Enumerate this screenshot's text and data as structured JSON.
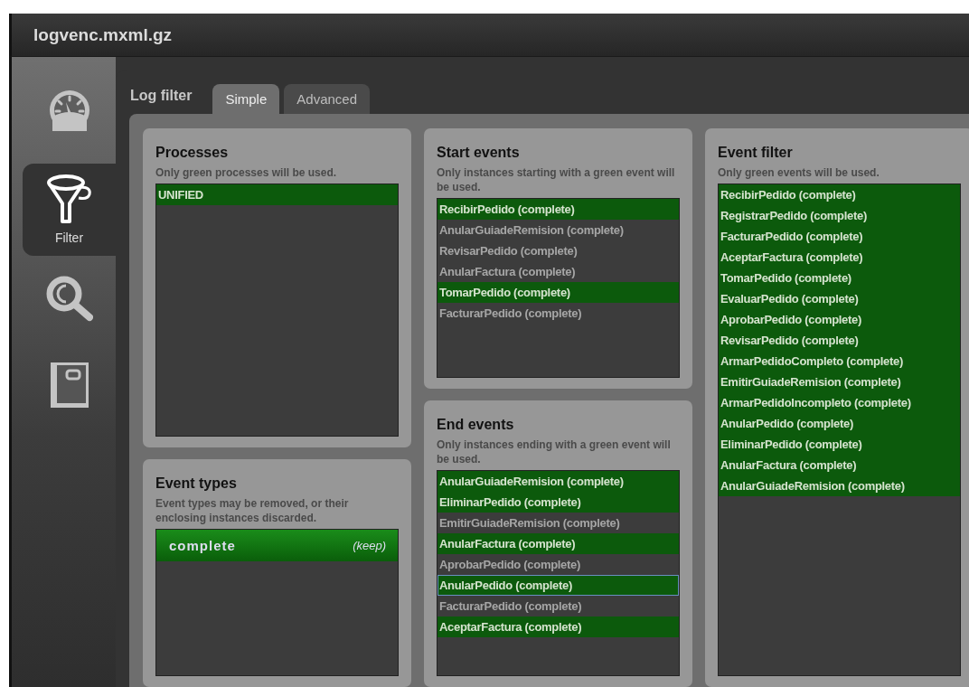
{
  "window": {
    "title": "logvenc.mxml.gz"
  },
  "sidebar": {
    "items": [
      {
        "kind": "dashboard",
        "selected": false
      },
      {
        "kind": "filter",
        "label": "Filter",
        "selected": true
      },
      {
        "kind": "search",
        "selected": false
      },
      {
        "kind": "book",
        "selected": false
      }
    ]
  },
  "log_filter": {
    "title": "Log filter",
    "tabs": [
      {
        "label": "Simple",
        "selected": true
      },
      {
        "label": "Advanced",
        "selected": false
      }
    ]
  },
  "processes": {
    "title": "Processes",
    "description": "Only green processes will be used.",
    "items": [
      {
        "label": "UNIFIED",
        "selected": true
      }
    ]
  },
  "event_types": {
    "title": "Event types",
    "description": "Event types may be removed, or their enclosing instances discarded.",
    "items": [
      {
        "label": "complete",
        "action": "(keep)",
        "selected": true
      }
    ]
  },
  "start_events": {
    "title": "Start events",
    "description": "Only instances starting with a green event will be used.",
    "items": [
      {
        "label": "RecibirPedido (complete)",
        "selected": true
      },
      {
        "label": "AnularGuiadeRemision (complete)",
        "selected": false
      },
      {
        "label": "RevisarPedido (complete)",
        "selected": false
      },
      {
        "label": "AnularFactura (complete)",
        "selected": false
      },
      {
        "label": "TomarPedido (complete)",
        "selected": true
      },
      {
        "label": "FacturarPedido (complete)",
        "selected": false
      }
    ]
  },
  "end_events": {
    "title": "End events",
    "description": "Only instances ending with a green event will be used.",
    "items": [
      {
        "label": "AnularGuiadeRemision (complete)",
        "selected": true,
        "focused": false
      },
      {
        "label": "EliminarPedido (complete)",
        "selected": true,
        "focused": false
      },
      {
        "label": "EmitirGuiadeRemision (complete)",
        "selected": false,
        "focused": false
      },
      {
        "label": "AnularFactura (complete)",
        "selected": true,
        "focused": false
      },
      {
        "label": "AprobarPedido (complete)",
        "selected": false,
        "focused": false
      },
      {
        "label": "AnularPedido (complete)",
        "selected": true,
        "focused": true
      },
      {
        "label": "FacturarPedido (complete)",
        "selected": false,
        "focused": false
      },
      {
        "label": "AceptarFactura (complete)",
        "selected": true,
        "focused": false
      }
    ]
  },
  "event_filter": {
    "title": "Event filter",
    "description": "Only green events will be used.",
    "items": [
      {
        "label": "RecibirPedido (complete)",
        "selected": true
      },
      {
        "label": "RegistrarPedido (complete)",
        "selected": true
      },
      {
        "label": "FacturarPedido (complete)",
        "selected": true
      },
      {
        "label": "AceptarFactura (complete)",
        "selected": true
      },
      {
        "label": "TomarPedido (complete)",
        "selected": true
      },
      {
        "label": "EvaluarPedido (complete)",
        "selected": true
      },
      {
        "label": "AprobarPedido (complete)",
        "selected": true
      },
      {
        "label": "RevisarPedido (complete)",
        "selected": true
      },
      {
        "label": "ArmarPedidoCompleto (complete)",
        "selected": true
      },
      {
        "label": "EmitirGuiadeRemision (complete)",
        "selected": true
      },
      {
        "label": "ArmarPedidoIncompleto (complete)",
        "selected": true
      },
      {
        "label": "AnularPedido (complete)",
        "selected": true
      },
      {
        "label": "EliminarPedido (complete)",
        "selected": true
      },
      {
        "label": "AnularFactura (complete)",
        "selected": true
      },
      {
        "label": "AnularGuiadeRemision (complete)",
        "selected": true
      }
    ]
  }
}
